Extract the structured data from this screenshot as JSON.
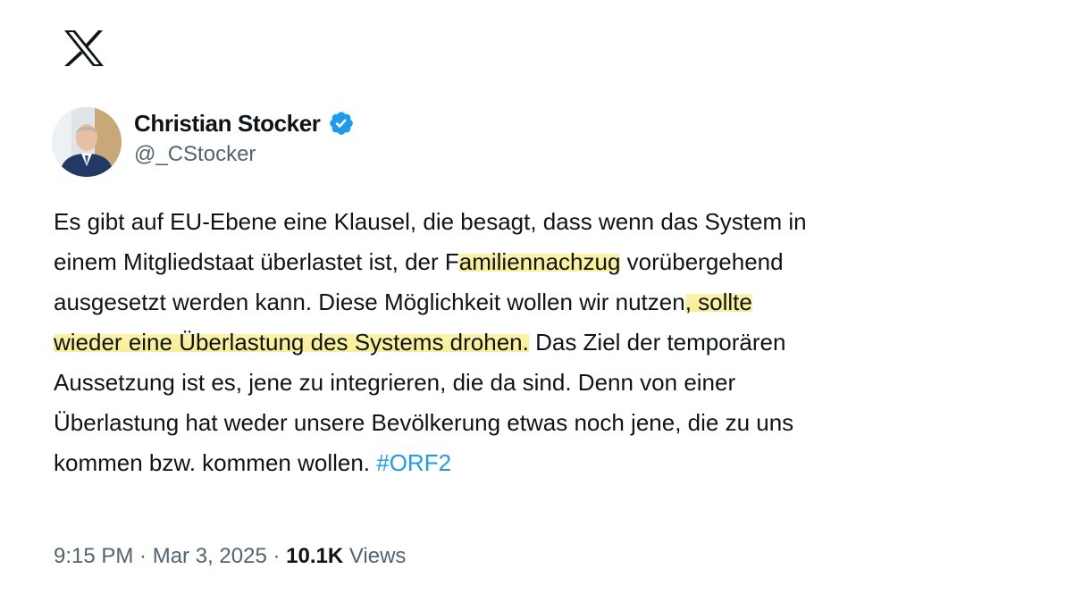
{
  "app": {
    "logo_icon": "x-logo-icon"
  },
  "author": {
    "name": "Christian Stocker",
    "handle": "@_CStocker",
    "verified_icon": "verified-badge-icon",
    "verified_color": "#1d9bf0"
  },
  "tweet": {
    "segments": {
      "l1": "Es gibt auf EU-Ebene eine Klausel, die besagt, dass wenn das System in",
      "l2a": "einem Mitgliedstaat überlastet ist, der F",
      "l2b": "amiliennachzug",
      "l2c": " vorübergehend",
      "l3a": "ausgesetzt werden kann. Diese Möglichkeit wollen wir nutzen",
      "l3b": ", sollte",
      "l4a": "wieder eine Überlastung des Systems drohen.",
      "l4b": " Das Ziel der temporären",
      "l5": "Aussetzung ist es, jene zu integrieren, die da sind. Denn von einer",
      "l6": "Überlastung hat weder unsere Bevölkerung etwas noch jene, die zu uns",
      "l7a": "kommen bzw. kommen wollen. ",
      "l7b": "#ORF2"
    },
    "highlight_color": "#f7ee98",
    "link_color": "#1d9bf0"
  },
  "meta": {
    "time": "9:15 PM",
    "separator": " · ",
    "date": "Mar 3, 2025",
    "views_count": "10.1K",
    "views_label": " Views"
  }
}
